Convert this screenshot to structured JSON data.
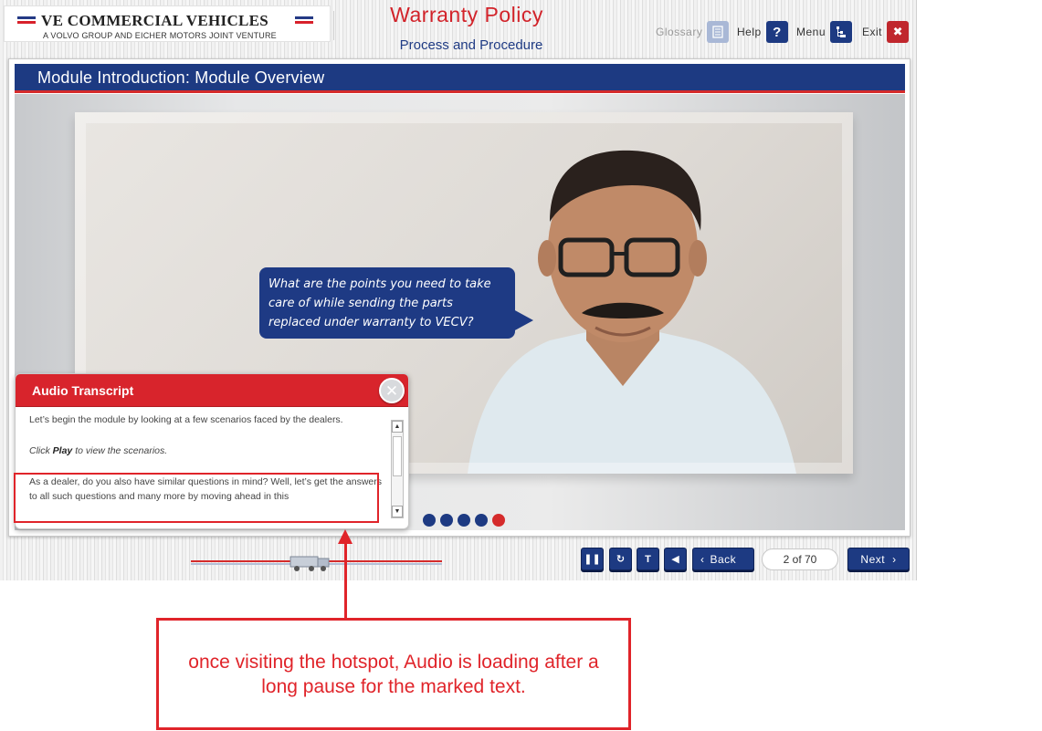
{
  "header": {
    "logo_title": "VE COMMERCIAL VEHICLES",
    "logo_subtitle": "A VOLVO GROUP AND EICHER MOTORS JOINT VENTURE",
    "course_title": "Warranty Policy",
    "course_subtitle": "Process and Procedure",
    "toolbar": {
      "glossary_label": "Glossary",
      "help_label": "Help",
      "menu_label": "Menu",
      "exit_label": "Exit"
    }
  },
  "slide": {
    "title": "Module Introduction: Module Overview",
    "speech_bubble": "What are the points you need to take care of while sending the parts replaced under warranty to VECV?",
    "progress": {
      "total_dots": 5,
      "active_index": 4
    }
  },
  "transcript": {
    "title": "Audio Transcript",
    "para1": "Let’s begin the module by looking at a few scenarios faced by the dealers.",
    "para2_prefix": "Click ",
    "para2_bold": "Play",
    "para2_suffix": " to view the scenarios.",
    "para3": "As a dealer, do you also have similar questions in mind? Well, let’s get the answers to all such questions and many more by moving ahead in this"
  },
  "footer": {
    "back_label": "Back",
    "next_label": "Next",
    "page_indicator": "2 of 70"
  },
  "annotation": {
    "note": "once visiting the hotspot, Audio is loading after a long pause for the marked text."
  },
  "colors": {
    "brand_blue": "#1d3a82",
    "brand_red": "#d52b2b",
    "annotation_red": "#e0242a"
  }
}
